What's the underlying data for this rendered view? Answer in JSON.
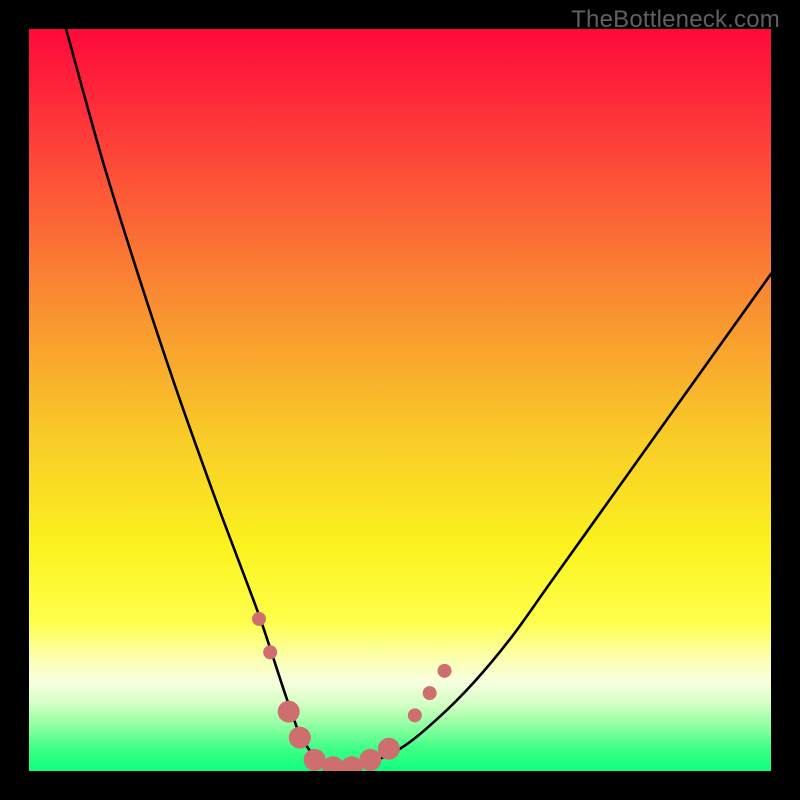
{
  "watermark": "TheBottleneck.com",
  "chart_data": {
    "type": "line",
    "title": "",
    "xlabel": "",
    "ylabel": "",
    "xlim": [
      0,
      100
    ],
    "ylim": [
      0,
      100
    ],
    "grid": false,
    "series": [
      {
        "name": "curve",
        "x": [
          5,
          10,
          15,
          20,
          25,
          28,
          31,
          33,
          35,
          37,
          40,
          45,
          50,
          55,
          60,
          65,
          70,
          75,
          80,
          85,
          90,
          95,
          100
        ],
        "values": [
          100,
          82,
          66,
          51,
          37,
          29,
          21,
          15,
          9,
          4,
          1,
          1,
          3,
          7,
          12,
          18,
          25,
          32,
          39,
          46,
          53,
          60,
          67
        ]
      }
    ],
    "markers": {
      "name": "highlighted-points",
      "color": "#cf6e6f",
      "points": [
        {
          "x": 31.0,
          "y": 20.5,
          "r": 7
        },
        {
          "x": 32.5,
          "y": 16.0,
          "r": 7
        },
        {
          "x": 35.0,
          "y": 8.0,
          "r": 11
        },
        {
          "x": 36.5,
          "y": 4.5,
          "r": 11
        },
        {
          "x": 38.5,
          "y": 1.5,
          "r": 11
        },
        {
          "x": 41.0,
          "y": 0.5,
          "r": 11
        },
        {
          "x": 43.5,
          "y": 0.5,
          "r": 11
        },
        {
          "x": 46.0,
          "y": 1.5,
          "r": 11
        },
        {
          "x": 48.5,
          "y": 3.0,
          "r": 11
        },
        {
          "x": 52.0,
          "y": 7.5,
          "r": 7
        },
        {
          "x": 54.0,
          "y": 10.5,
          "r": 7
        },
        {
          "x": 56.0,
          "y": 13.5,
          "r": 7
        }
      ]
    },
    "background_gradient": {
      "stops": [
        {
          "pct": 0,
          "color": "#fe093c"
        },
        {
          "pct": 10,
          "color": "#fe2c3a"
        },
        {
          "pct": 25,
          "color": "#fb6336"
        },
        {
          "pct": 40,
          "color": "#f99930"
        },
        {
          "pct": 55,
          "color": "#f9cb28"
        },
        {
          "pct": 70,
          "color": "#fbf31f"
        },
        {
          "pct": 80,
          "color": "#feff4d"
        },
        {
          "pct": 85,
          "color": "#fcffb3"
        },
        {
          "pct": 88,
          "color": "#f8ffdf"
        },
        {
          "pct": 91,
          "color": "#d3ffc4"
        },
        {
          "pct": 94,
          "color": "#8effa0"
        },
        {
          "pct": 97,
          "color": "#3eff87"
        },
        {
          "pct": 100,
          "color": "#0dff7e"
        }
      ]
    }
  }
}
